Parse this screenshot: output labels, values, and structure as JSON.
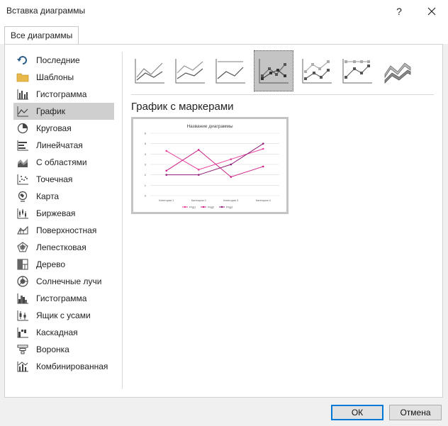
{
  "window": {
    "title": "Вставка диаграммы",
    "help_label": "?",
    "close_label": "✕"
  },
  "tabs": [
    {
      "label": "Все диаграммы",
      "active": true
    }
  ],
  "sidebar": {
    "items": [
      {
        "label": "Последние",
        "icon": "recent-icon"
      },
      {
        "label": "Шаблоны",
        "icon": "folder-icon"
      },
      {
        "label": "Гистограмма",
        "icon": "column-chart-icon"
      },
      {
        "label": "График",
        "icon": "line-chart-icon",
        "selected": true
      },
      {
        "label": "Круговая",
        "icon": "pie-chart-icon"
      },
      {
        "label": "Линейчатая",
        "icon": "bar-chart-icon"
      },
      {
        "label": "С областями",
        "icon": "area-chart-icon"
      },
      {
        "label": "Точечная",
        "icon": "scatter-chart-icon"
      },
      {
        "label": "Карта",
        "icon": "map-chart-icon"
      },
      {
        "label": "Биржевая",
        "icon": "stock-chart-icon"
      },
      {
        "label": "Поверхностная",
        "icon": "surface-chart-icon"
      },
      {
        "label": "Лепестковая",
        "icon": "radar-chart-icon"
      },
      {
        "label": "Дерево",
        "icon": "treemap-chart-icon"
      },
      {
        "label": "Солнечные лучи",
        "icon": "sunburst-chart-icon"
      },
      {
        "label": "Гистограмма",
        "icon": "histogram-chart-icon"
      },
      {
        "label": "Ящик с усами",
        "icon": "box-whisker-chart-icon"
      },
      {
        "label": "Каскадная",
        "icon": "waterfall-chart-icon"
      },
      {
        "label": "Воронка",
        "icon": "funnel-chart-icon"
      },
      {
        "label": "Комбинированная",
        "icon": "combo-chart-icon"
      }
    ]
  },
  "subtypes": [
    {
      "icon": "line-icon",
      "selected": false
    },
    {
      "icon": "stacked-line-icon",
      "selected": false
    },
    {
      "icon": "percent-stacked-line-icon",
      "selected": false
    },
    {
      "icon": "line-markers-icon",
      "selected": true
    },
    {
      "icon": "stacked-line-markers-icon",
      "selected": false
    },
    {
      "icon": "percent-stacked-line-markers-icon",
      "selected": false
    },
    {
      "icon": "3d-line-icon",
      "selected": false
    }
  ],
  "selected_subtype_label": "График с маркерами",
  "preview": {
    "chart_data": {
      "type": "line",
      "title": "Название диаграммы",
      "categories": [
        "Категория 1",
        "Категория 2",
        "Категория 3",
        "Категория 4"
      ],
      "series": [
        {
          "name": "Ряд1",
          "values": [
            4.3,
            2.5,
            3.5,
            4.5
          ],
          "color": "#e83e9c"
        },
        {
          "name": "Ряд2",
          "values": [
            2.4,
            4.4,
            1.8,
            2.8
          ],
          "color": "#cc1f86"
        },
        {
          "name": "Ряд3",
          "values": [
            2,
            2,
            3,
            5
          ],
          "color": "#8e1a78"
        }
      ],
      "ylim": [
        0,
        6
      ],
      "yticks": [
        "0",
        "1",
        "2",
        "3",
        "4",
        "5",
        "6"
      ],
      "grid": true,
      "legend": "bottom"
    }
  },
  "buttons": {
    "ok": "ОК",
    "cancel": "Отмена"
  },
  "colors": {
    "accent": "#0078d7",
    "selected_bg": "#cfcfcf"
  }
}
